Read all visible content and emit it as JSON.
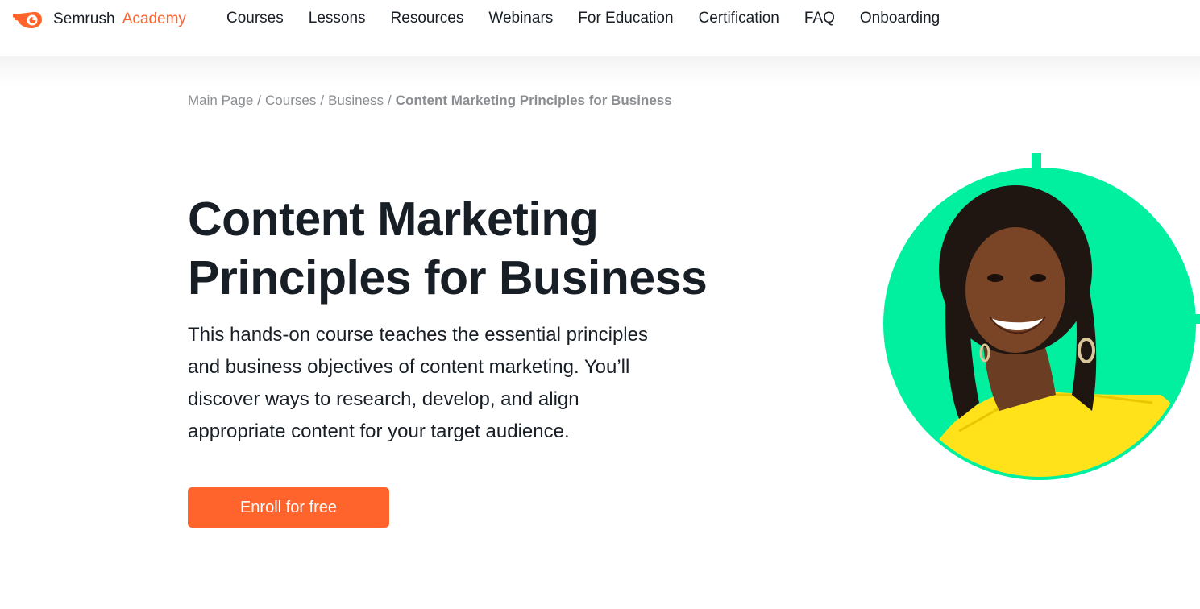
{
  "header": {
    "brand": "Semrush",
    "brand_suffix": "Academy",
    "logo_icon": "semrush-fire-icon",
    "nav": [
      {
        "label": "Courses"
      },
      {
        "label": "Lessons"
      },
      {
        "label": "Resources"
      },
      {
        "label": "Webinars"
      },
      {
        "label": "For Education"
      },
      {
        "label": "Certification"
      },
      {
        "label": "FAQ"
      },
      {
        "label": "Onboarding"
      }
    ]
  },
  "breadcrumb": {
    "items": [
      "Main Page",
      "Courses",
      "Business"
    ],
    "separator": "/",
    "current": "Content Marketing Principles for Business"
  },
  "hero": {
    "title_line1": "Content Marketing",
    "title_line2": "Principles for Business",
    "description_line1": "This hands-on course teaches the essential principles",
    "description_line2": "and business objectives of content marketing. You’ll",
    "description_line3": "discover ways to research, develop, and align",
    "description_line4": "appropriate content for your target audience.",
    "cta_label": "Enroll for free"
  },
  "colors": {
    "accent": "#ff642d",
    "text": "#181e25",
    "muted": "#8a8d91",
    "portrait_ring": "#00f0a0",
    "portrait_outfit": "#ffe21a"
  }
}
